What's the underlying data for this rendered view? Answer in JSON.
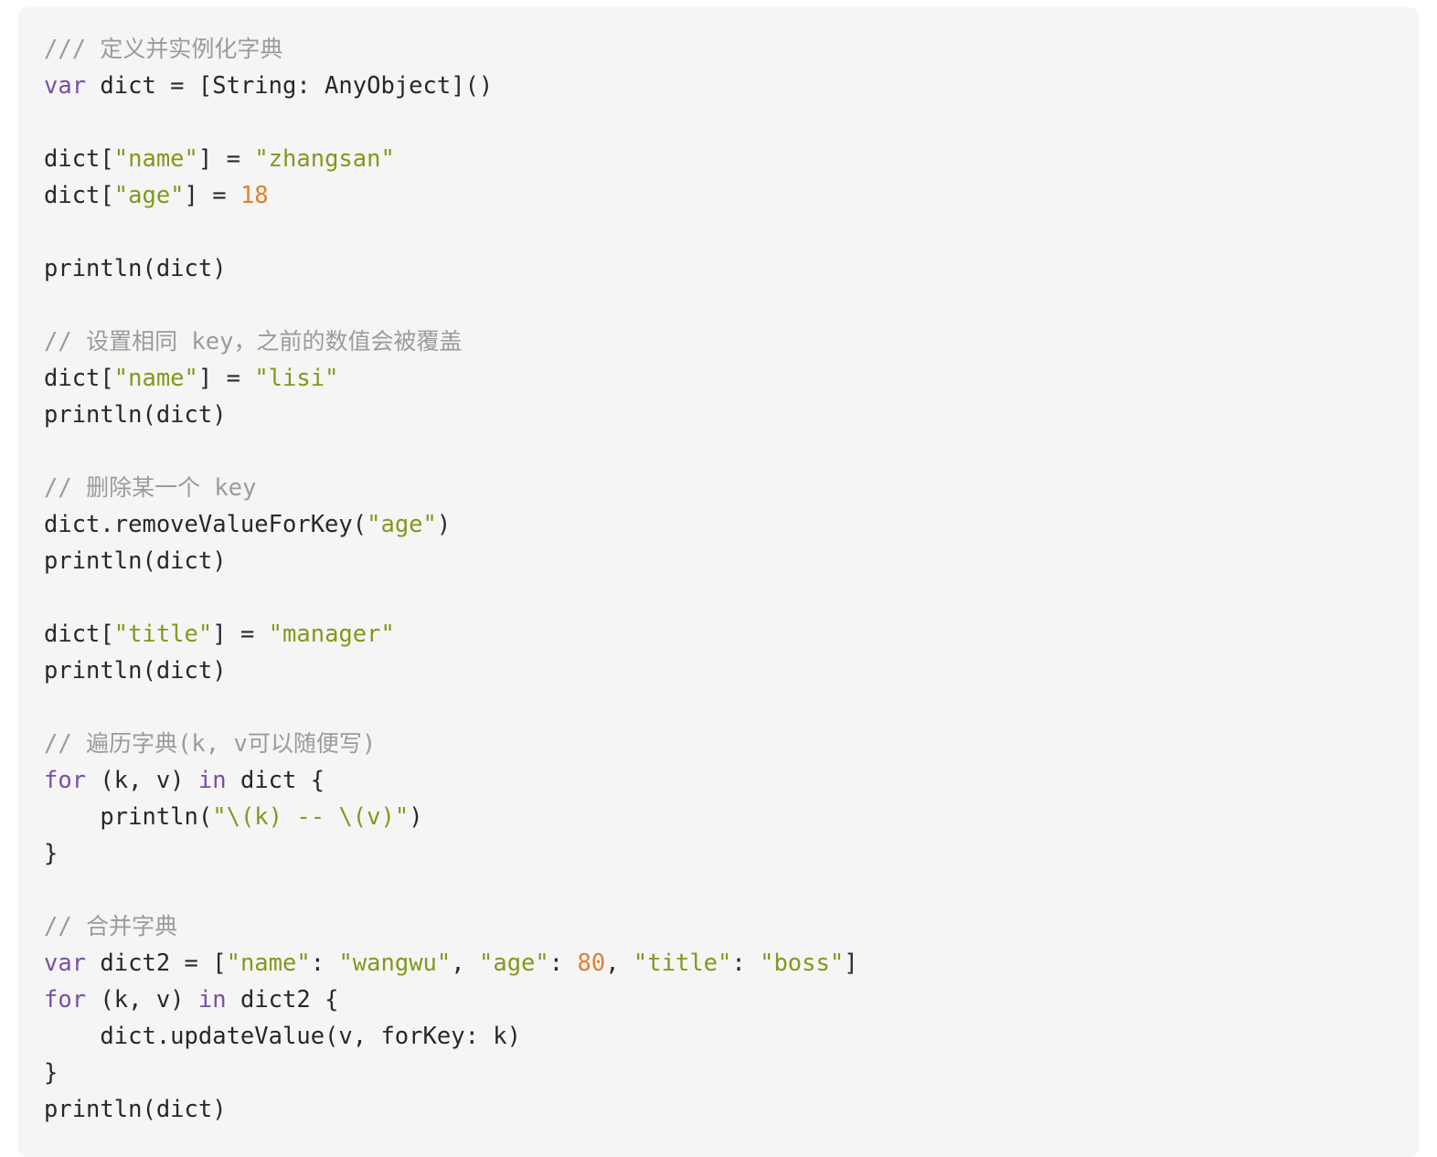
{
  "code_block": {
    "language": "swift",
    "background_color": "#f5f5f5",
    "page_background_color": "#ffffff",
    "colors": {
      "comment": "#9b9b9b",
      "keyword": "#7a4fa3",
      "string": "#7f9a1c",
      "number": "#e2802c",
      "function": "#e2802c",
      "plain": "#24292e"
    },
    "lines": [
      {
        "n": 1,
        "tokens": [
          {
            "t": "comment",
            "v": "/// 定义并实例化字典"
          }
        ]
      },
      {
        "n": 2,
        "tokens": [
          {
            "t": "keyword",
            "v": "var"
          },
          {
            "t": "plain",
            "v": " dict = [String: AnyObject]()"
          }
        ]
      },
      {
        "n": 3,
        "tokens": [
          {
            "t": "plain",
            "v": ""
          }
        ]
      },
      {
        "n": 4,
        "tokens": [
          {
            "t": "plain",
            "v": "dict["
          },
          {
            "t": "string",
            "v": "\"name\""
          },
          {
            "t": "plain",
            "v": "] = "
          },
          {
            "t": "string",
            "v": "\"zhangsan\""
          }
        ]
      },
      {
        "n": 5,
        "tokens": [
          {
            "t": "plain",
            "v": "dict["
          },
          {
            "t": "string",
            "v": "\"age\""
          },
          {
            "t": "plain",
            "v": "] = "
          },
          {
            "t": "number",
            "v": "18"
          }
        ]
      },
      {
        "n": 6,
        "tokens": [
          {
            "t": "plain",
            "v": ""
          }
        ]
      },
      {
        "n": 7,
        "tokens": [
          {
            "t": "function",
            "v": "println"
          },
          {
            "t": "plain",
            "v": "(dict)"
          }
        ]
      },
      {
        "n": 8,
        "tokens": [
          {
            "t": "plain",
            "v": ""
          }
        ]
      },
      {
        "n": 9,
        "tokens": [
          {
            "t": "comment",
            "v": "// 设置相同 key，之前的数值会被覆盖"
          }
        ]
      },
      {
        "n": 10,
        "tokens": [
          {
            "t": "plain",
            "v": "dict["
          },
          {
            "t": "string",
            "v": "\"name\""
          },
          {
            "t": "plain",
            "v": "] = "
          },
          {
            "t": "string",
            "v": "\"lisi\""
          }
        ]
      },
      {
        "n": 11,
        "tokens": [
          {
            "t": "function",
            "v": "println"
          },
          {
            "t": "plain",
            "v": "(dict)"
          }
        ]
      },
      {
        "n": 12,
        "tokens": [
          {
            "t": "plain",
            "v": ""
          }
        ]
      },
      {
        "n": 13,
        "tokens": [
          {
            "t": "comment",
            "v": "// 删除某一个 key"
          }
        ]
      },
      {
        "n": 14,
        "tokens": [
          {
            "t": "plain",
            "v": "dict.removeValueForKey("
          },
          {
            "t": "string",
            "v": "\"age\""
          },
          {
            "t": "plain",
            "v": ")"
          }
        ]
      },
      {
        "n": 15,
        "tokens": [
          {
            "t": "function",
            "v": "println"
          },
          {
            "t": "plain",
            "v": "(dict)"
          }
        ]
      },
      {
        "n": 16,
        "tokens": [
          {
            "t": "plain",
            "v": ""
          }
        ]
      },
      {
        "n": 17,
        "tokens": [
          {
            "t": "plain",
            "v": "dict["
          },
          {
            "t": "string",
            "v": "\"title\""
          },
          {
            "t": "plain",
            "v": "] = "
          },
          {
            "t": "string",
            "v": "\"manager\""
          }
        ]
      },
      {
        "n": 18,
        "tokens": [
          {
            "t": "function",
            "v": "println"
          },
          {
            "t": "plain",
            "v": "(dict)"
          }
        ]
      },
      {
        "n": 19,
        "tokens": [
          {
            "t": "plain",
            "v": ""
          }
        ]
      },
      {
        "n": 20,
        "tokens": [
          {
            "t": "comment",
            "v": "// 遍历字典(k, v可以随便写)"
          }
        ]
      },
      {
        "n": 21,
        "tokens": [
          {
            "t": "keyword",
            "v": "for"
          },
          {
            "t": "plain",
            "v": " (k, v) "
          },
          {
            "t": "keyword",
            "v": "in"
          },
          {
            "t": "plain",
            "v": " dict {"
          }
        ]
      },
      {
        "n": 22,
        "tokens": [
          {
            "t": "plain",
            "v": "    "
          },
          {
            "t": "function",
            "v": "println"
          },
          {
            "t": "plain",
            "v": "("
          },
          {
            "t": "string",
            "v": "\"\\(k) -- \\(v)\""
          },
          {
            "t": "plain",
            "v": ")"
          }
        ]
      },
      {
        "n": 23,
        "tokens": [
          {
            "t": "plain",
            "v": "}"
          }
        ]
      },
      {
        "n": 24,
        "tokens": [
          {
            "t": "plain",
            "v": ""
          }
        ]
      },
      {
        "n": 25,
        "tokens": [
          {
            "t": "comment",
            "v": "// 合并字典"
          }
        ]
      },
      {
        "n": 26,
        "tokens": [
          {
            "t": "keyword",
            "v": "var"
          },
          {
            "t": "plain",
            "v": " dict2 = ["
          },
          {
            "t": "string",
            "v": "\"name\""
          },
          {
            "t": "plain",
            "v": ": "
          },
          {
            "t": "string",
            "v": "\"wangwu\""
          },
          {
            "t": "plain",
            "v": ", "
          },
          {
            "t": "string",
            "v": "\"age\""
          },
          {
            "t": "plain",
            "v": ": "
          },
          {
            "t": "number",
            "v": "80"
          },
          {
            "t": "plain",
            "v": ", "
          },
          {
            "t": "string",
            "v": "\"title\""
          },
          {
            "t": "plain",
            "v": ": "
          },
          {
            "t": "string",
            "v": "\"boss\""
          },
          {
            "t": "plain",
            "v": "]"
          }
        ]
      },
      {
        "n": 27,
        "tokens": [
          {
            "t": "keyword",
            "v": "for"
          },
          {
            "t": "plain",
            "v": " (k, v) "
          },
          {
            "t": "keyword",
            "v": "in"
          },
          {
            "t": "plain",
            "v": " dict2 {"
          }
        ]
      },
      {
        "n": 28,
        "tokens": [
          {
            "t": "plain",
            "v": "    dict.updateValue(v, forKey: k)"
          }
        ]
      },
      {
        "n": 29,
        "tokens": [
          {
            "t": "plain",
            "v": "}"
          }
        ]
      },
      {
        "n": 30,
        "tokens": [
          {
            "t": "function",
            "v": "println"
          },
          {
            "t": "plain",
            "v": "(dict)"
          }
        ]
      }
    ]
  }
}
